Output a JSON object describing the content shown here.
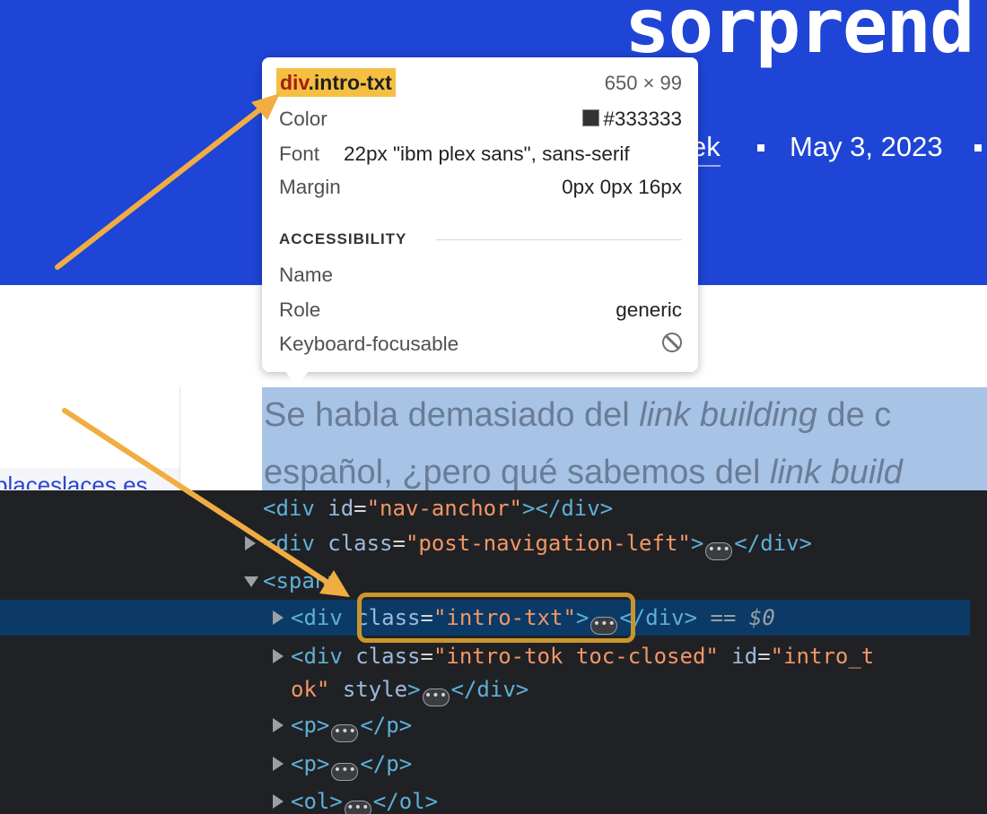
{
  "hero": {
    "title": "sorprend",
    "author": "ek",
    "date": "May 3, 2023"
  },
  "sidebar": {
    "link_text": "placeslaces.es"
  },
  "intro": {
    "line1_before": "Se habla demasiado del ",
    "line1_em": "link building",
    "line1_after": " de c",
    "line2_before": "español, ¿pero qué sabemos del ",
    "line2_em": "link build"
  },
  "tooltip": {
    "selector_tag": "div",
    "selector_class": ".intro-txt",
    "size": "650 × 99",
    "color_label": "Color",
    "color_value": "#333333",
    "font_label": "Font",
    "font_value": "22px \"ibm plex sans\", sans-serif",
    "margin_label": "Margin",
    "margin_value": "0px 0px 16px",
    "section_title": "ACCESSIBILITY",
    "name_label": "Name",
    "name_value": "",
    "role_label": "Role",
    "role_value": "generic",
    "focus_label": "Keyboard-focusable",
    "focus_icon": "not-allowed-icon"
  },
  "devtools": {
    "row1": {
      "open": "<div",
      "attr": "id",
      "eq": "=",
      "val": "\"nav-anchor\"",
      "close": "></div>"
    },
    "row2": {
      "open": "<div",
      "attr": "class",
      "eq": "=",
      "val": "\"post-navigation-left\"",
      "close_a": ">",
      "close_b": "</div>"
    },
    "row3": {
      "open": "<span>"
    },
    "row4": {
      "open": "<div",
      "attr": "class",
      "eq": "=",
      "val": "\"intro-txt\"",
      "close_a": ">",
      "close_b": "</div>",
      "ref": "== $0"
    },
    "row5": {
      "open": "<div",
      "attr1": "class",
      "eq": "=",
      "val1": "\"intro-tok toc-closed\"",
      "attr2": "id",
      "val2a": "\"intro_t"
    },
    "row6": {
      "val2b": "ok\"",
      "attr3": "style",
      "close_a": ">",
      "close_b": "</div>"
    },
    "row7": {
      "open": "<p>",
      "close": "</p>"
    },
    "row8": {
      "open": "<p>",
      "close": "</p>"
    },
    "row9": {
      "open": "<ol>",
      "close": "</ol>"
    }
  },
  "colors": {
    "hero_bg": "#1f45d6",
    "highlight": "#f5bf42",
    "arrow": "#f1ad42",
    "devtools_bg": "#202124",
    "selected_row": "#0c3a66"
  }
}
